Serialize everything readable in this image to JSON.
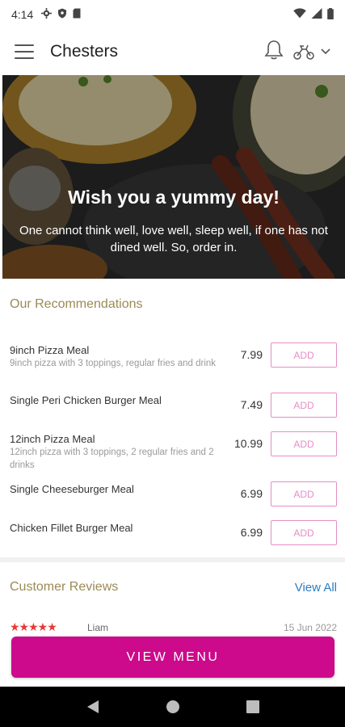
{
  "status_bar": {
    "time": "4:14",
    "icons": [
      "settings-icon",
      "shield-icon",
      "sim-card-icon",
      "wifi-icon",
      "signal-icon",
      "battery-icon"
    ]
  },
  "app_bar": {
    "title": "Chesters",
    "icons": [
      "menu-icon",
      "bell-icon",
      "scooter-icon",
      "chevron-down-icon"
    ]
  },
  "hero": {
    "headline": "Wish you a yummy day!",
    "subtext": "One cannot think well, love well, sleep well, if one has not dined well. So, order in."
  },
  "recommendations": {
    "title": "Our Recommendations",
    "add_label": "ADD",
    "items": [
      {
        "name": "9inch Pizza Meal",
        "description": "9inch pizza with 3 toppings, regular fries and drink",
        "price": "7.99"
      },
      {
        "name": "Single Peri Chicken Burger Meal",
        "description": "",
        "price": "7.49"
      },
      {
        "name": "12inch Pizza Meal",
        "description": "12inch pizza with 3 toppings, 2 regular fries and 2 drinks",
        "price": "10.99"
      },
      {
        "name": "Single Cheeseburger Meal",
        "description": "",
        "price": "6.99"
      },
      {
        "name": "Chicken Fillet Burger Meal",
        "description": "",
        "price": "6.99"
      }
    ]
  },
  "reviews": {
    "title": "Customer Reviews",
    "view_all": "View All",
    "peek": {
      "stars": "★★★★★",
      "name": "Liam",
      "date": "15 Jun 2022"
    }
  },
  "cta": {
    "label": "VIEW MENU"
  },
  "nav_bar": {
    "icons": [
      "back-icon",
      "home-icon",
      "recents-icon"
    ]
  },
  "colors": {
    "accent": "#cc0a8b",
    "add_border": "#e58ec4",
    "section_title": "#9b8a55",
    "link": "#2e7dbf",
    "stars": "#e53935"
  }
}
